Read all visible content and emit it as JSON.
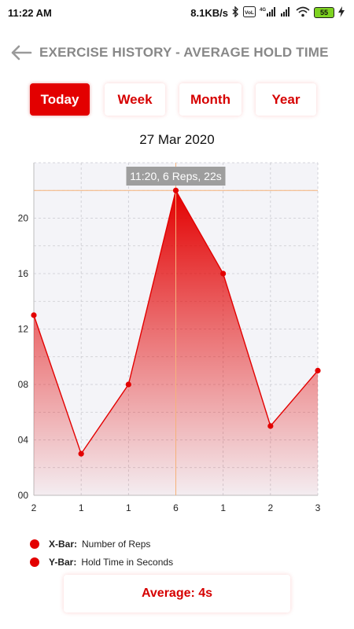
{
  "status_bar": {
    "time": "11:22 AM",
    "net_speed": "8.1KB/s",
    "volte": "Vo LTE",
    "network": "4G",
    "battery": "55"
  },
  "header": {
    "back_icon": "arrow-left-icon",
    "title": "EXERCISE HISTORY - AVERAGE HOLD TIME"
  },
  "tabs": [
    {
      "label": "Today",
      "active": true
    },
    {
      "label": "Week",
      "active": false
    },
    {
      "label": "Month",
      "active": false
    },
    {
      "label": "Year",
      "active": false
    }
  ],
  "date": "27 Mar 2020",
  "chart_data": {
    "type": "area",
    "title": "",
    "xlabel": "",
    "ylabel": "",
    "categories": [
      "2",
      "1",
      "1",
      "6",
      "1",
      "2",
      "3"
    ],
    "series": [
      {
        "values": [
          13,
          3,
          8,
          22,
          16,
          5,
          9
        ]
      }
    ],
    "y_ticks": [
      "00",
      "04",
      "08",
      "12",
      "16",
      "20"
    ],
    "ylim": [
      0,
      24
    ],
    "grid": true,
    "highlight": {
      "index": 3,
      "label": "11:20, 6 Reps, 22s"
    },
    "colors": {
      "line": "#e30000",
      "fill": "#e30000",
      "plot_bg": "#f4f4f8",
      "crosshair": "#f5b27a",
      "tooltip_bg": "#9e9e9e"
    }
  },
  "legend": [
    {
      "key": "X-Bar:",
      "value": "Number of Reps"
    },
    {
      "key": "Y-Bar:",
      "value": "Hold Time in Seconds"
    }
  ],
  "average": "Average: 4s"
}
